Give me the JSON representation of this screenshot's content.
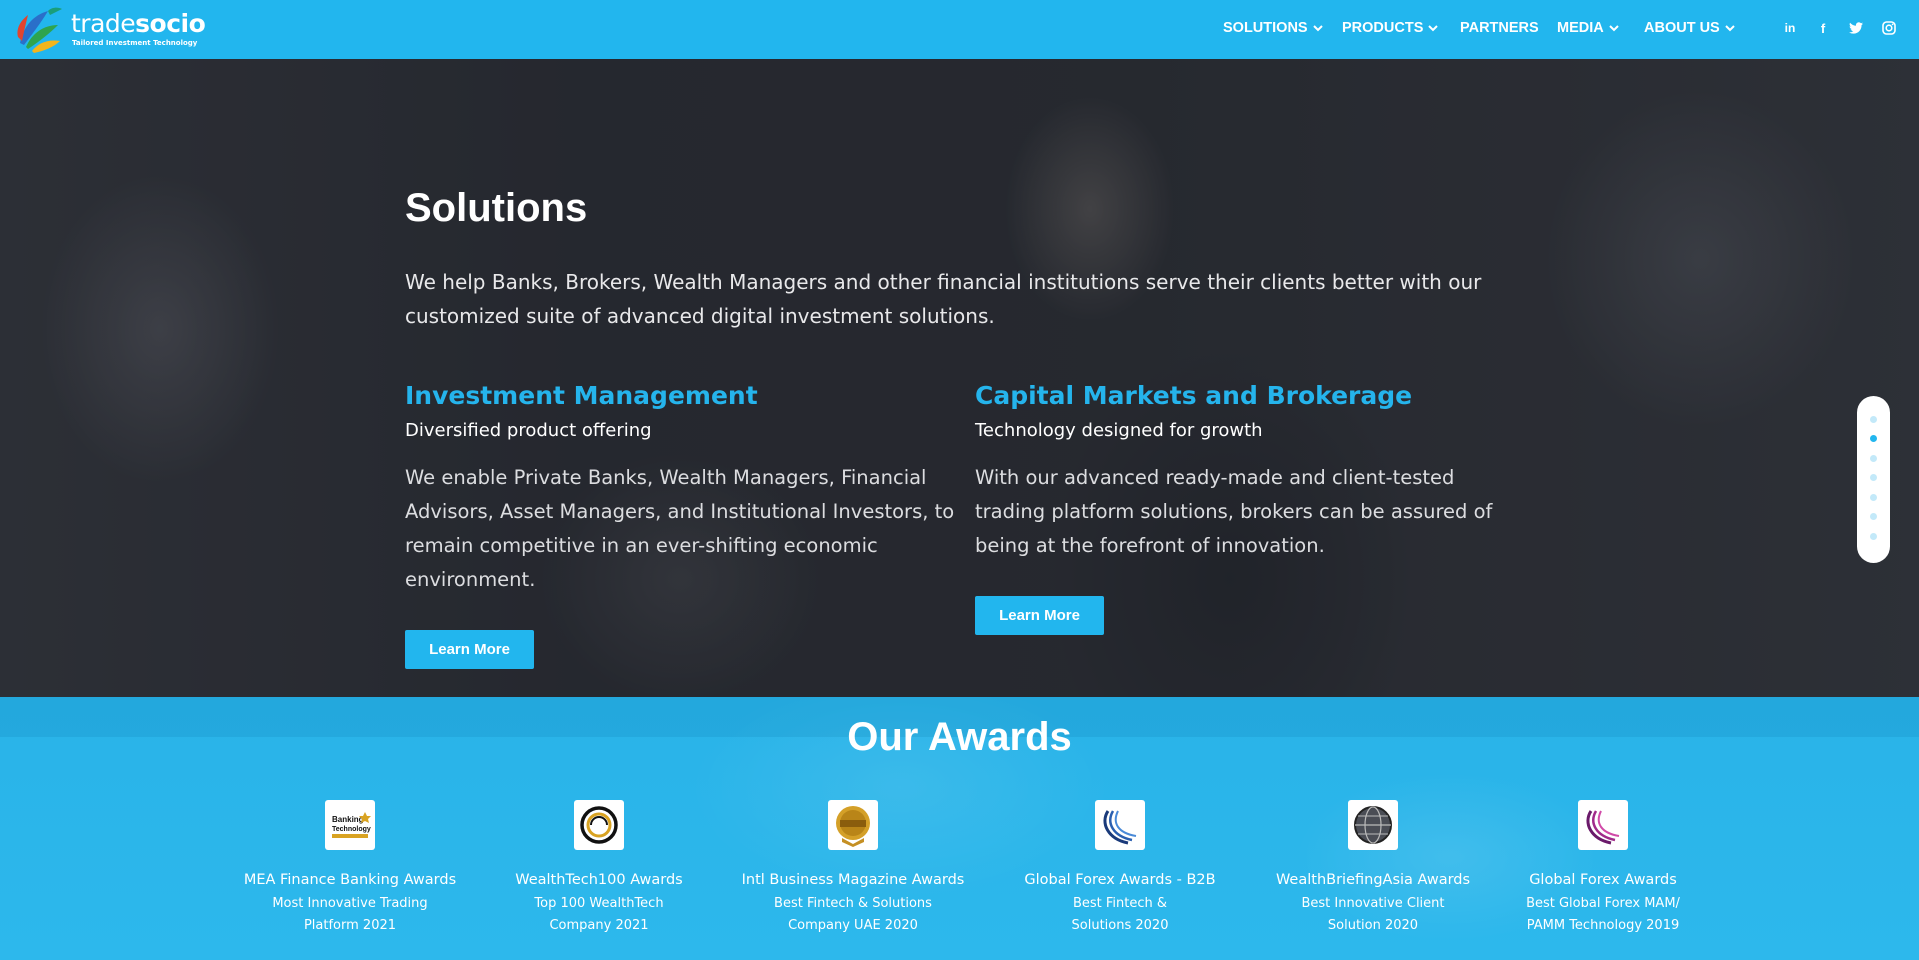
{
  "brand": {
    "name_part1": "trade",
    "name_part2": "socio",
    "tagline": "Tailored Investment Technology"
  },
  "nav": {
    "items": [
      {
        "label": "SOLUTIONS",
        "has_dropdown": true
      },
      {
        "label": "PRODUCTS",
        "has_dropdown": true
      },
      {
        "label": "PARTNERS",
        "has_dropdown": false
      },
      {
        "label": "MEDIA",
        "has_dropdown": true
      },
      {
        "label": "ABOUT US",
        "has_dropdown": true
      }
    ],
    "social": [
      {
        "icon": "linkedin-icon",
        "glyph": "in"
      },
      {
        "icon": "facebook-icon",
        "glyph": "f"
      },
      {
        "icon": "twitter-icon",
        "glyph": "t"
      },
      {
        "icon": "instagram-icon",
        "glyph": "◎"
      }
    ]
  },
  "hero": {
    "title": "Solutions",
    "intro": "We help Banks, Brokers, Wealth Managers and other financial institutions serve their clients better with our customized suite of advanced digital investment solutions.",
    "columns": [
      {
        "heading": "Investment Management",
        "subheading": "Diversified product offering",
        "body": "We enable Private Banks, Wealth Managers, Financial Advisors, Asset Managers, and Institutional Investors, to remain competitive in an ever-shifting economic environment.",
        "button": "Learn More"
      },
      {
        "heading": "Capital Markets and Brokerage",
        "subheading": "Technology designed for growth",
        "body": "With our advanced ready-made and client-tested trading platform solutions, brokers can be assured of being at the forefront of innovation.",
        "button": "Learn More"
      }
    ]
  },
  "section_nav": {
    "count": 7,
    "active_index": 1
  },
  "awards": {
    "title": "Our Awards",
    "items": [
      {
        "name": "MEA Finance Banking Awards",
        "desc_line1": "Most Innovative Trading",
        "desc_line2": "Platform 2021",
        "logo_text": "Banking Technology"
      },
      {
        "name": "WealthTech100 Awards",
        "desc_line1": "Top 100 WealthTech",
        "desc_line2": "Company 2021",
        "logo_text": ""
      },
      {
        "name": "Intl Business Magazine Awards",
        "desc_line1": "Best Fintech & Solutions",
        "desc_line2": "Company UAE 2020",
        "logo_text": ""
      },
      {
        "name": "Global Forex Awards - B2B",
        "desc_line1": "Best Fintech &",
        "desc_line2": "Solutions 2020",
        "logo_text": ""
      },
      {
        "name": "WealthBriefingAsia Awards",
        "desc_line1": "Best Innovative Client",
        "desc_line2": "Solution 2020",
        "logo_text": ""
      },
      {
        "name": "Global Forex Awards",
        "desc_line1": "Best Global Forex MAM/",
        "desc_line2": "PAMM Technology 2019",
        "logo_text": ""
      }
    ]
  },
  "colors": {
    "accent": "#22b6ee",
    "heading_blue": "#25b4ec",
    "hero_overlay": "#2a2d33"
  }
}
